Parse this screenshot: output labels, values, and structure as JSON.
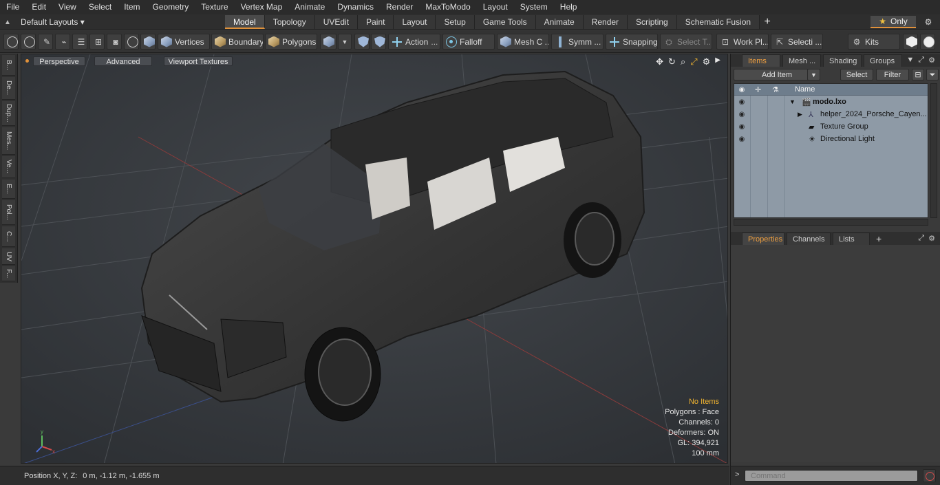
{
  "menu": [
    "File",
    "Edit",
    "View",
    "Select",
    "Item",
    "Geometry",
    "Texture",
    "Vertex Map",
    "Animate",
    "Dynamics",
    "Render",
    "MaxToModo",
    "Layout",
    "System",
    "Help"
  ],
  "layouts": {
    "label": "Default Layouts ▾"
  },
  "tabs": [
    "Model",
    "Topology",
    "UVEdit",
    "Paint",
    "Layout",
    "Setup",
    "Game Tools",
    "Animate",
    "Render",
    "Scripting",
    "Schematic Fusion"
  ],
  "only_label": "Only",
  "toolbar": {
    "vertices": "Vertices",
    "boundary": "Boundary",
    "polygons": "Polygons",
    "action": "Action",
    "falloff": "Falloff",
    "mesh": "Mesh C ...",
    "symm": "Symm ...",
    "snapping": "Snapping",
    "select_t": "Select T...",
    "work_pl": "Work Pl...",
    "selecti": "Selecti ...",
    "kits": "Kits"
  },
  "vstrip": [
    "B...",
    "De...",
    "Dup...",
    "Mes...",
    "Ve...",
    "E...",
    "Pol...",
    "C...",
    "UV",
    "F..."
  ],
  "viewport": {
    "perspective": "Perspective",
    "advanced": "Advanced",
    "textures": "Viewport Textures"
  },
  "stats": {
    "no_items": "No Items",
    "polygons": "Polygons : Face",
    "channels": "Channels: 0",
    "deformers": "Deformers: ON",
    "gl": "GL: 394,921",
    "scale": "100 mm"
  },
  "status": {
    "label": "Position X, Y, Z:",
    "value": "0 m, -1.12 m, -1.655 m"
  },
  "items_tabs": [
    "Items",
    "Mesh ...",
    "Shading",
    "Groups"
  ],
  "items_bar": {
    "add_item": "Add Item",
    "select": "Select",
    "filter": "Filter"
  },
  "items_list": {
    "name_header": "Name",
    "rows": [
      {
        "label": "modo.lxo"
      },
      {
        "label": "helper_2024_Porsche_Cayen..."
      },
      {
        "label": "Texture Group"
      },
      {
        "label": "Directional Light"
      }
    ]
  },
  "props_tabs": [
    "Properties",
    "Channels",
    "Lists"
  ],
  "command": {
    "placeholder": "Command"
  },
  "colors": {
    "accent": "#e0913a",
    "warn": "#f2b530",
    "list_bg": "#8e9aa6"
  }
}
